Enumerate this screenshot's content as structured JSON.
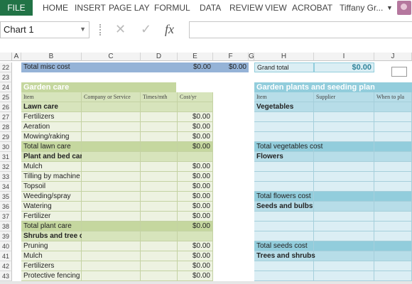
{
  "ribbon": {
    "file": "FILE",
    "tabs": [
      "HOME",
      "INSERT",
      "PAGE LAY",
      "FORMUL",
      "DATA",
      "REVIEW",
      "VIEW",
      "ACROBAT"
    ],
    "user": "Tiffany Gr...",
    "accent": "#217346"
  },
  "formula_bar": {
    "name_box": "Chart 1",
    "fx": "fx",
    "formula": ""
  },
  "columns": [
    "A",
    "B",
    "C",
    "D",
    "E",
    "F",
    "G",
    "H",
    "I",
    "J"
  ],
  "rows": [
    "22",
    "23",
    "24",
    "25",
    "26",
    "27",
    "28",
    "29",
    "30",
    "31",
    "32",
    "33",
    "34",
    "35",
    "36",
    "37",
    "38",
    "39",
    "40",
    "41",
    "42",
    "43"
  ],
  "misc": {
    "label": "Total misc cost",
    "e": "$0.00",
    "f": "$0.00"
  },
  "grand_total": {
    "label": "Grand total",
    "value": "$0.00"
  },
  "garden_care": {
    "title": "Garden care",
    "headers": [
      "Item",
      "Company or Service",
      "Times/mth",
      "Cost/yr"
    ],
    "lines": [
      {
        "label": "Lawn care",
        "cost": "",
        "type": "section"
      },
      {
        "label": "Fertilizers",
        "cost": "$0.00",
        "type": "item"
      },
      {
        "label": "Aeration",
        "cost": "$0.00",
        "type": "item"
      },
      {
        "label": "Mowing/raking",
        "cost": "$0.00",
        "type": "item"
      },
      {
        "label": "Total lawn care",
        "cost": "$0.00",
        "type": "total"
      },
      {
        "label": "Plant and bed care",
        "cost": "",
        "type": "section"
      },
      {
        "label": "Mulch",
        "cost": "$0.00",
        "type": "item"
      },
      {
        "label": "Tilling by machine",
        "cost": "$0.00",
        "type": "item"
      },
      {
        "label": "Topsoil",
        "cost": "$0.00",
        "type": "item"
      },
      {
        "label": "Weeding/spray",
        "cost": "$0.00",
        "type": "item"
      },
      {
        "label": "Watering",
        "cost": "$0.00",
        "type": "item"
      },
      {
        "label": "Fertilizer",
        "cost": "$0.00",
        "type": "item"
      },
      {
        "label": "Total plant care",
        "cost": "$0.00",
        "type": "total"
      },
      {
        "label": "Shrubs and tree care",
        "cost": "",
        "type": "section"
      },
      {
        "label": "Pruning",
        "cost": "$0.00",
        "type": "item"
      },
      {
        "label": "Mulch",
        "cost": "$0.00",
        "type": "item"
      },
      {
        "label": "Fertilizers",
        "cost": "$0.00",
        "type": "item"
      },
      {
        "label": "Protective fencing",
        "cost": "$0.00",
        "type": "item"
      }
    ]
  },
  "plants": {
    "title": "Garden plants and seeding plan",
    "headers": [
      "Item",
      "Supplier",
      "When to pla"
    ],
    "lines": [
      {
        "label": "Vegetables",
        "type": "section"
      },
      {
        "label": "",
        "type": "item"
      },
      {
        "label": "",
        "type": "item"
      },
      {
        "label": "",
        "type": "item"
      },
      {
        "label": "Total vegetables cost",
        "type": "total"
      },
      {
        "label": "Flowers",
        "type": "section"
      },
      {
        "label": "",
        "type": "item"
      },
      {
        "label": "",
        "type": "item"
      },
      {
        "label": "",
        "type": "item"
      },
      {
        "label": "Total flowers cost",
        "type": "total"
      },
      {
        "label": "Seeds and bulbs",
        "type": "section"
      },
      {
        "label": "",
        "type": "item"
      },
      {
        "label": "",
        "type": "item"
      },
      {
        "label": "",
        "type": "item"
      },
      {
        "label": "Total seeds cost",
        "type": "total"
      },
      {
        "label": "Trees and shrubs",
        "type": "section"
      },
      {
        "label": "",
        "type": "item"
      },
      {
        "label": "",
        "type": "item"
      }
    ]
  }
}
